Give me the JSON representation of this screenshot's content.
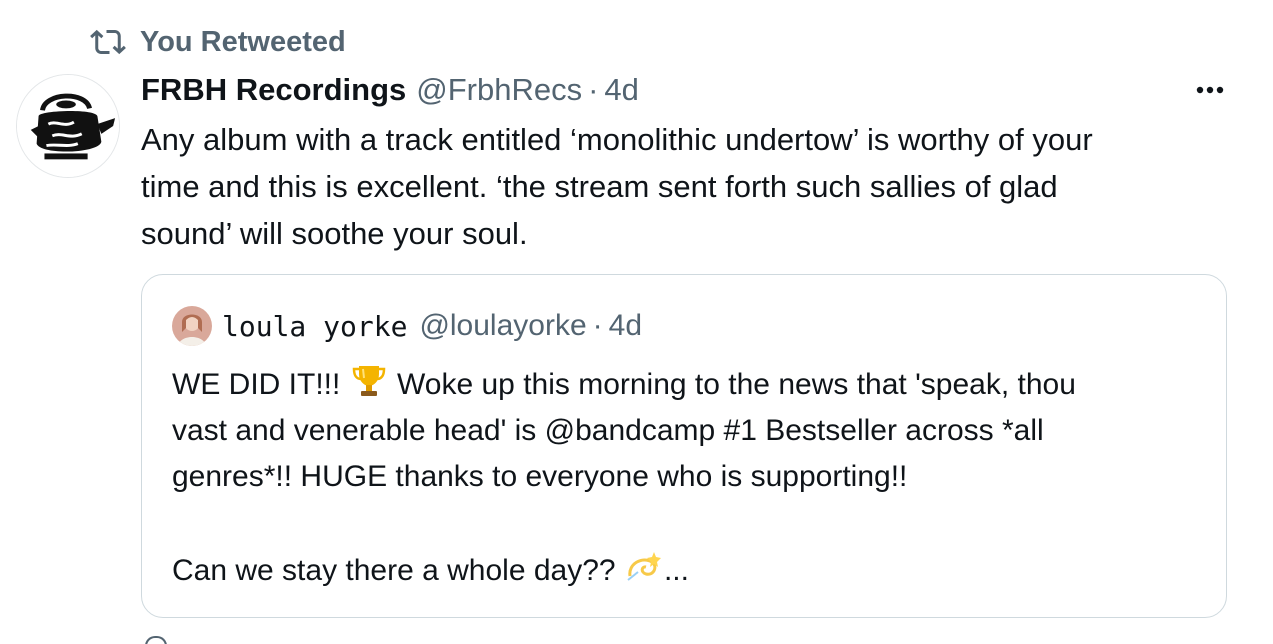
{
  "retweet_banner": {
    "icon": "retweet-icon",
    "label": "You Retweeted"
  },
  "tweet": {
    "author": {
      "display_name": "FRBH Recordings",
      "handle": "@FrbhRecs",
      "avatar": "kettle-drawing-avatar"
    },
    "separator": "·",
    "time": "4d",
    "more_icon": "more-horizontal-icon",
    "text_lines": [
      "Any album with a track entitled ‘monolithic undertow’ is worthy of your",
      "time and this is excellent. ‘the stream sent forth such sallies of glad",
      "sound’ will soothe your soul."
    ]
  },
  "quote": {
    "author": {
      "display_name": "loula yorke",
      "handle": "@loulayorke",
      "avatar": "profile-photo-avatar"
    },
    "separator": "·",
    "time": "4d",
    "line1_before_emoji": "WE DID IT!!! ",
    "emoji_trophy": "trophy-emoji",
    "line1_after_emoji": " Woke up this morning  to the news that 'speak, thou",
    "line2": "vast and venerable head' is @bandcamp #1 Bestseller across *all",
    "line3": "genres*!! HUGE thanks to everyone who is supporting!!",
    "line4": "",
    "line5_before_emoji": "Can we stay there a whole day?? ",
    "emoji_dizzy": "dizzy-emoji",
    "line5_after_emoji": "..."
  }
}
